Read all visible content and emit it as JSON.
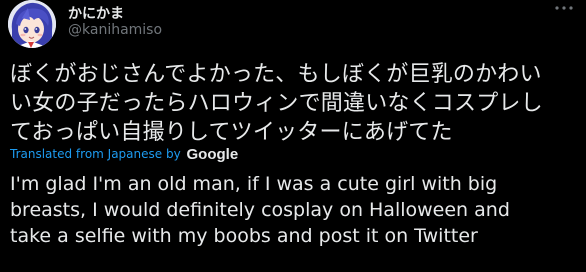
{
  "user": {
    "display_name": "かにかま",
    "handle": "@kanihamiso"
  },
  "icons": {
    "avatar": "avatar-anime-character",
    "more": "more-options-icon"
  },
  "tweet": {
    "original_lines": [
      "ぼくがおじさんでよかった、もしぼくが巨乳のかわい",
      "い女の子だったらハロウィンで間違いなくコスプレし",
      "ておっぱい自撮りしてツイッターにあげてた"
    ],
    "translated_from": "Translated from Japanese by",
    "translator": "Google",
    "translation_lines": [
      "I'm glad I'm an old man, if I was a cute girl with big",
      "breasts, I would definitely cosplay on Halloween and",
      "take a selfie with my boobs and post it on Twitter"
    ]
  },
  "colors": {
    "background": "#000000",
    "text": "#e7e9ea",
    "secondary": "#71767b",
    "link": "#1d9bf0"
  }
}
